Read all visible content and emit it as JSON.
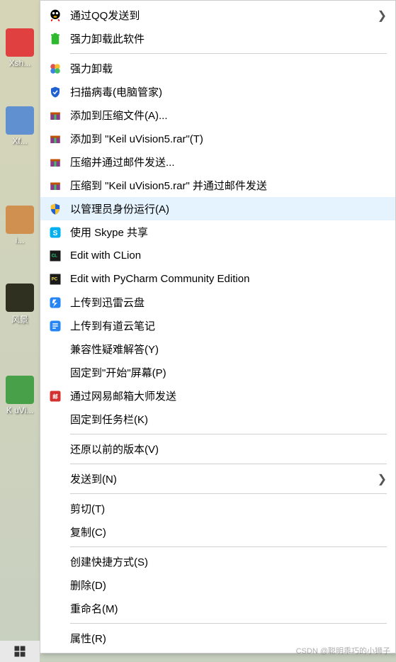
{
  "desktop": {
    "icons": [
      {
        "label": "Xsh...",
        "color": "#e04040"
      },
      {
        "label": "Xf...",
        "color": "#6090d0"
      },
      {
        "label": "i...",
        "color": "#d09050"
      },
      {
        "label": "风景",
        "color": "#303020"
      },
      {
        "label": "K uVi...",
        "color": "#48a048"
      }
    ]
  },
  "menu": {
    "items": [
      {
        "label": "通过QQ发送到",
        "icon": "qq",
        "submenu": true
      },
      {
        "label": "强力卸载此软件",
        "icon": "trash-green"
      },
      {
        "sep": true
      },
      {
        "label": "强力卸载",
        "icon": "clover"
      },
      {
        "label": "扫描病毒(电脑管家)",
        "icon": "shield-blue"
      },
      {
        "label": "添加到压缩文件(A)...",
        "icon": "winrar"
      },
      {
        "label": "添加到 \"Keil uVision5.rar\"(T)",
        "icon": "winrar"
      },
      {
        "label": "压缩并通过邮件发送...",
        "icon": "winrar"
      },
      {
        "label": "压缩到 \"Keil uVision5.rar\" 并通过邮件发送",
        "icon": "winrar"
      },
      {
        "label": "以管理员身份运行(A)",
        "icon": "uac-shield",
        "highlighted": true
      },
      {
        "label": "使用 Skype 共享",
        "icon": "skype"
      },
      {
        "label": "Edit with CLion",
        "icon": "clion"
      },
      {
        "label": "Edit with PyCharm Community Edition",
        "icon": "pycharm"
      },
      {
        "label": "上传到迅雷云盘",
        "icon": "xunlei"
      },
      {
        "label": "上传到有道云笔记",
        "icon": "youdao"
      },
      {
        "label": "兼容性疑难解答(Y)",
        "icon": ""
      },
      {
        "label": "固定到\"开始\"屏幕(P)",
        "icon": ""
      },
      {
        "label": "通过网易邮箱大师发送",
        "icon": "netease-mail"
      },
      {
        "label": "固定到任务栏(K)",
        "icon": ""
      },
      {
        "sep": true
      },
      {
        "label": "还原以前的版本(V)",
        "icon": ""
      },
      {
        "sep": true
      },
      {
        "label": "发送到(N)",
        "icon": "",
        "submenu": true
      },
      {
        "sep": true
      },
      {
        "label": "剪切(T)",
        "icon": ""
      },
      {
        "label": "复制(C)",
        "icon": ""
      },
      {
        "sep": true
      },
      {
        "label": "创建快捷方式(S)",
        "icon": ""
      },
      {
        "label": "删除(D)",
        "icon": ""
      },
      {
        "label": "重命名(M)",
        "icon": ""
      },
      {
        "sep": true
      },
      {
        "label": "属性(R)",
        "icon": ""
      }
    ]
  },
  "watermark": "CSDN @聪明乖巧的小狮子"
}
